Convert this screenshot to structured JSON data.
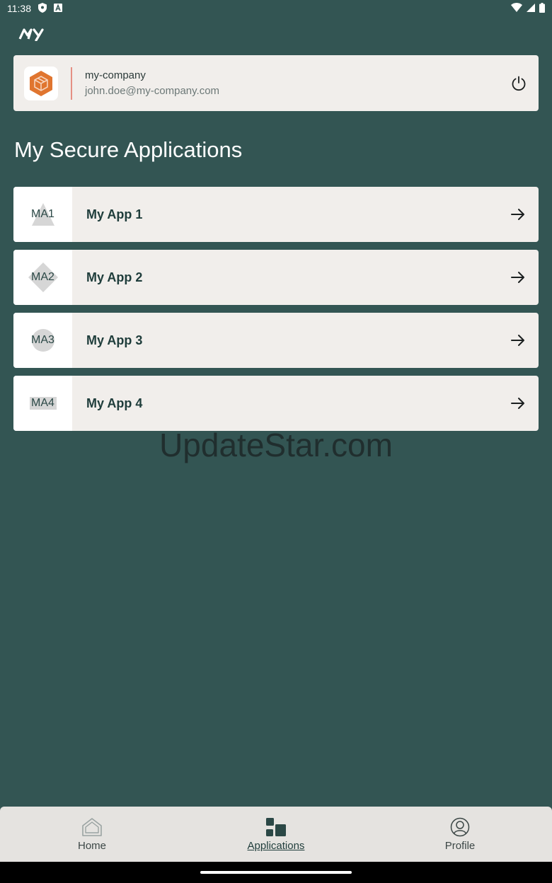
{
  "status_bar": {
    "time": "11:38",
    "left_icons": [
      "shield-icon",
      "a-badge-icon"
    ],
    "right_icons": [
      "wifi-icon",
      "cell-signal-icon",
      "battery-icon"
    ]
  },
  "brand": {
    "logo_text": "MY"
  },
  "account": {
    "company": "my-company",
    "email": "john.doe@my-company.com",
    "logo_color": "#e0752f",
    "divider_color": "#e58f83"
  },
  "page": {
    "title": "My Secure Applications"
  },
  "apps": [
    {
      "abbr": "MA1",
      "name": "My App 1",
      "shape": "triangle"
    },
    {
      "abbr": "MA2",
      "name": "My App 2",
      "shape": "diamond"
    },
    {
      "abbr": "MA3",
      "name": "My App 3",
      "shape": "circle"
    },
    {
      "abbr": "MA4",
      "name": "My App 4",
      "shape": "rectangle"
    }
  ],
  "watermark": "UpdateStar.com",
  "bottom_nav": {
    "items": [
      {
        "label": "Home",
        "icon": "home-icon",
        "active": false
      },
      {
        "label": "Applications",
        "icon": "applications-icon",
        "active": true
      },
      {
        "label": "Profile",
        "icon": "profile-icon",
        "active": false
      }
    ]
  },
  "colors": {
    "background": "#335553",
    "card": "#f1eeeb",
    "accent": "#1f3d3b",
    "nav_background": "#e5e3e0"
  }
}
